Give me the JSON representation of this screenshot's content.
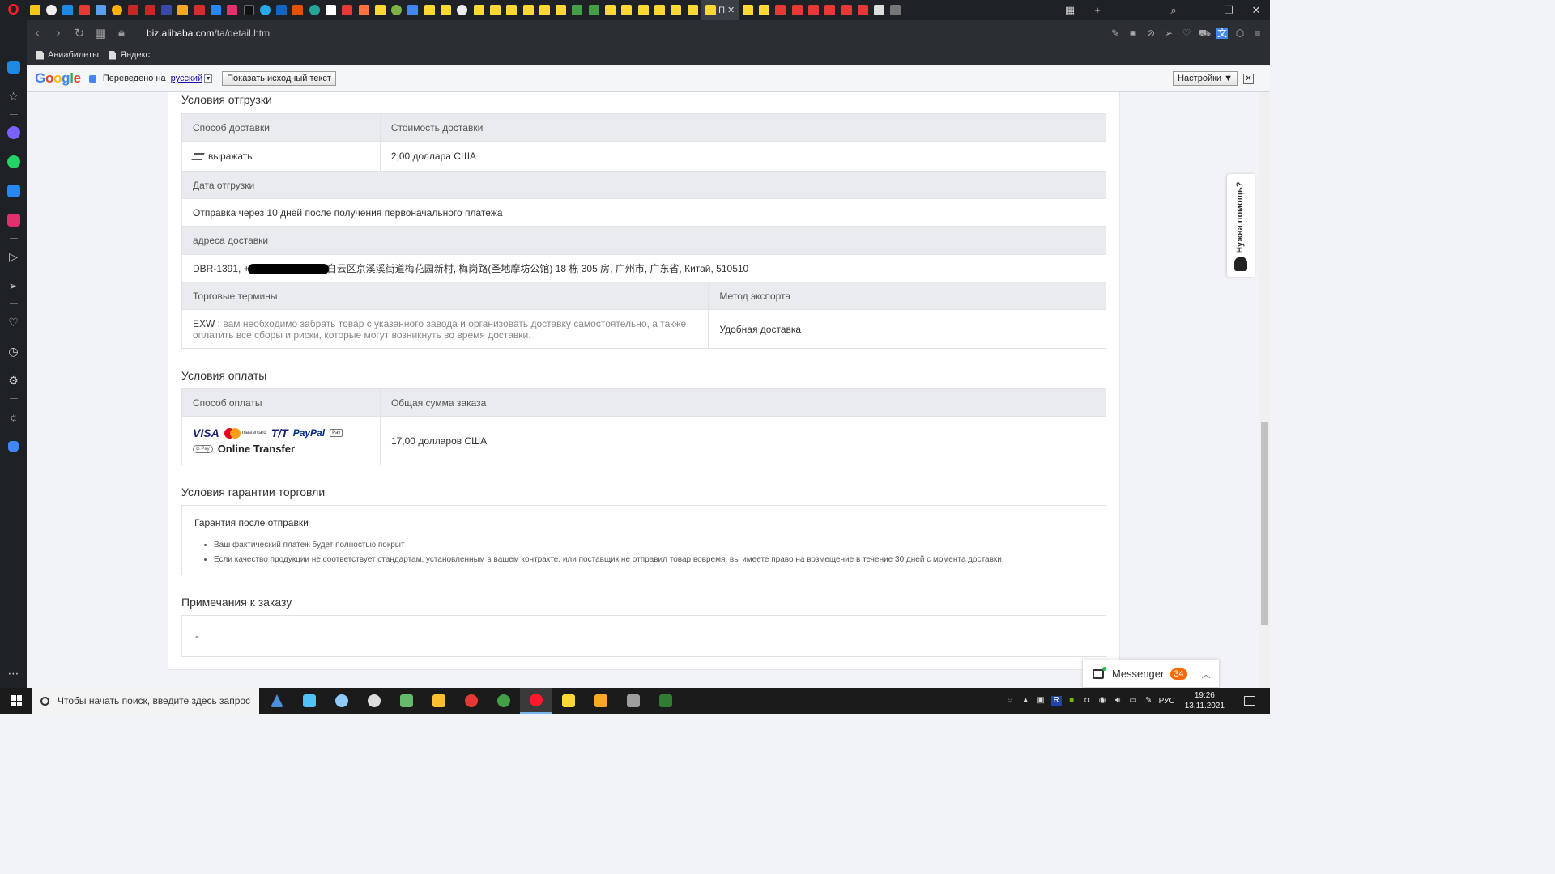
{
  "browser": {
    "url_domain": "biz.alibaba.com",
    "url_path": "/ta/detail.htm",
    "active_tab_title": "П",
    "bookmarks": [
      "Авиабилеты",
      "Яндекс"
    ],
    "colors": {
      "tab_strip": "#1e2126",
      "address_bar": "#2b2e33",
      "opera_red": "#ff1b2d"
    }
  },
  "translate_bar": {
    "logo": "Google",
    "translated_to": "Переведено на",
    "language": "русский",
    "show_original": "Показать исходный текст",
    "settings": "Настройки ▼"
  },
  "shipping": {
    "title": "Условия отгрузки",
    "method_header": "Способ доставки",
    "cost_header": "Стоимость доставки",
    "method_value": "выражать",
    "cost_value": "2,00 доллара США",
    "date_header": "Дата отгрузки",
    "date_value": "Отправка через 10 дней после получения первоначального платежа",
    "address_header": "адреса доставки",
    "address_prefix": "DBR-1391, +",
    "address_rest": "白云区京溪溪街道梅花园新村, 梅岗路(圣地摩坊公馆) 18 栋 305 房, 广州市, 广东省, Китай, 510510",
    "terms_header": "Торговые термины",
    "export_header": "Метод экспорта",
    "terms_key": "EXW :",
    "terms_value": "вам необходимо забрать товар с указанного завода и организовать доставку самостоятельно, а также оплатить все сборы и риски, которые могут возникнуть во время доставки.",
    "export_value": "Удобная доставка"
  },
  "payment": {
    "title": "Условия оплаты",
    "method_header": "Способ оплаты",
    "total_header": "Общая сумма заказа",
    "logos": [
      "VISA",
      "mastercard",
      "T/T",
      "PayPal",
      "Pay",
      "G Pay"
    ],
    "online_transfer": "Online Transfer",
    "total_value": "17,00 долларов США"
  },
  "guarantee": {
    "title": "Условия гарантии торговли",
    "subtitle": "Гарантия после отправки",
    "items": [
      "Ваш фактический платеж будет полностью покрыт",
      "Если качество продукции не соответствует стандартам, установленным в вашем контракте, или поставщик не отправил товар вовремя, вы имеете право на возмещение в течение 30 дней с момента доставки."
    ]
  },
  "notes": {
    "title": "Примечания к заказу",
    "value": "-"
  },
  "help_tab": "Нужна помощь?",
  "messenger": {
    "label": "Messenger",
    "count": "34",
    "accent": "#ff6a00"
  },
  "taskbar": {
    "search_placeholder": "Чтобы начать поиск, введите здесь запрос",
    "lang": "РУС",
    "time": "19:26",
    "date": "13.11.2021"
  }
}
